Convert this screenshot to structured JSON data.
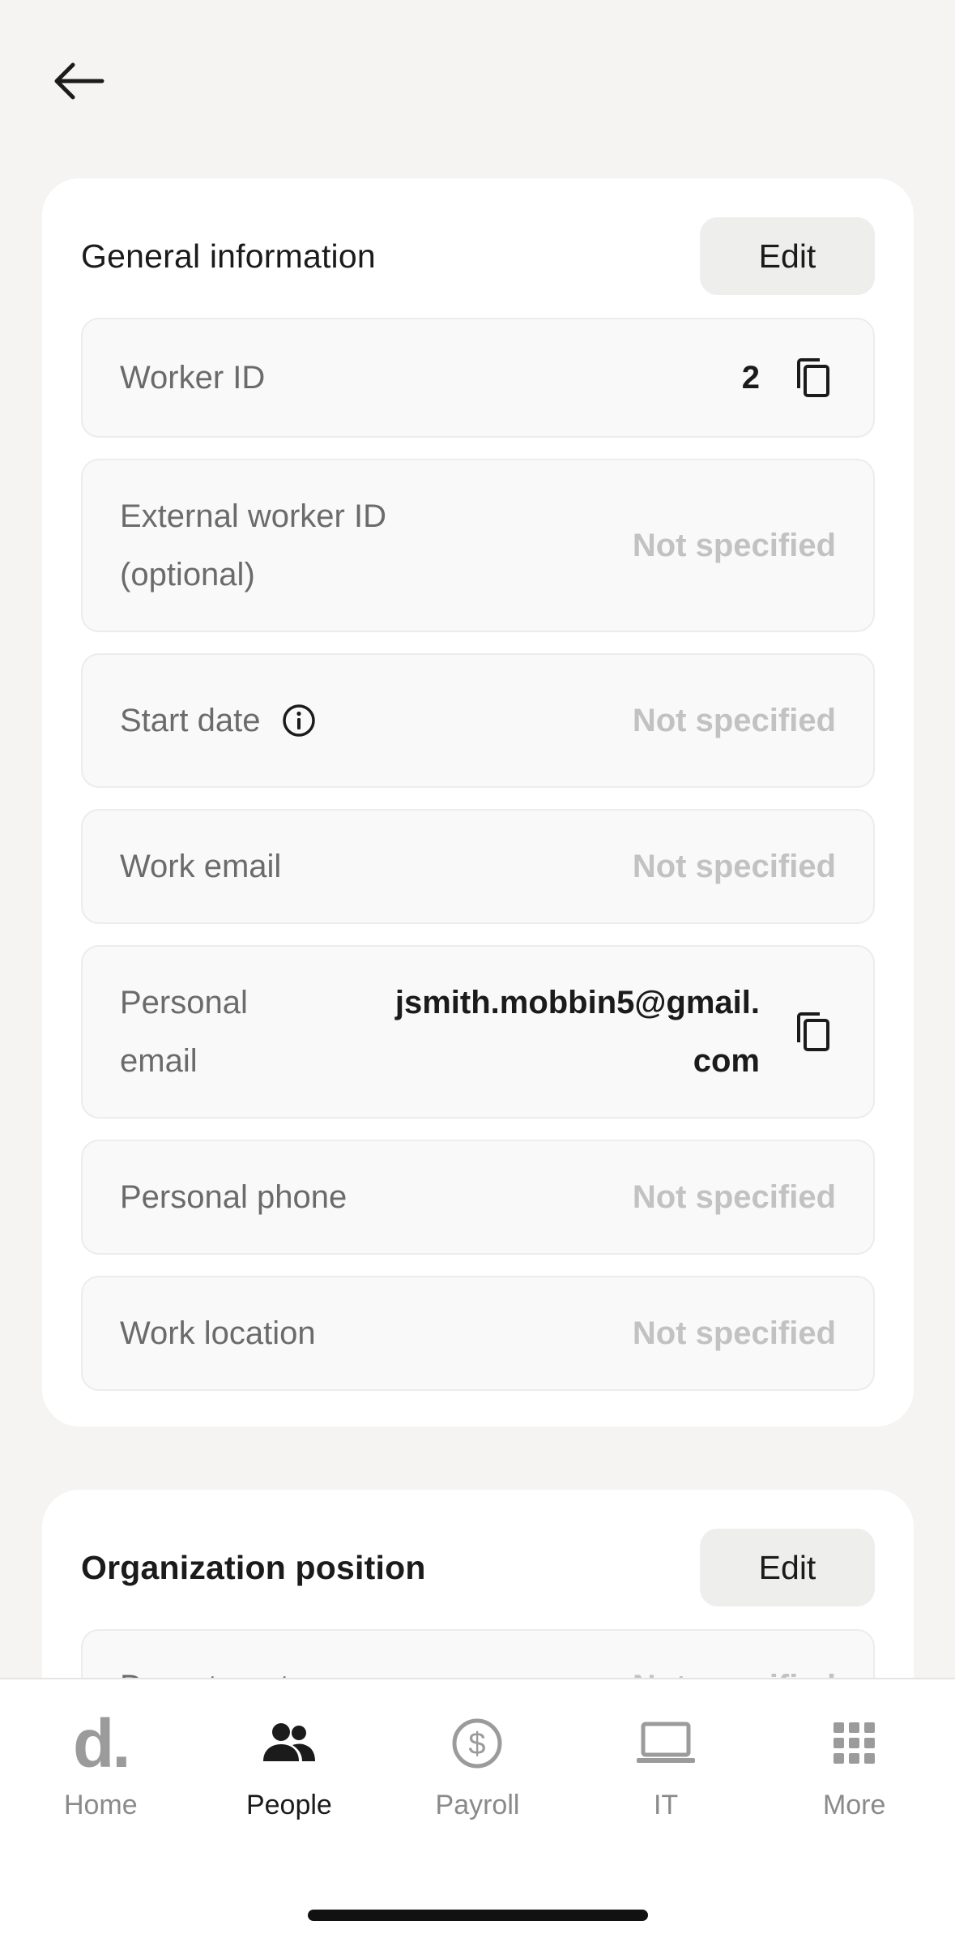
{
  "nav": {
    "back_icon": "arrow-left-icon"
  },
  "general": {
    "title": "General information",
    "edit_label": "Edit",
    "fields": {
      "worker_id": {
        "label": "Worker ID",
        "value": "2"
      },
      "external_worker_id": {
        "label": "External worker ID (optional)",
        "value": "Not specified"
      },
      "start_date": {
        "label": "Start date",
        "value": "Not specified"
      },
      "work_email": {
        "label": "Work email",
        "value": "Not specified"
      },
      "personal_email": {
        "label": "Personal email",
        "value": "jsmith.mobbin5@gmail.com"
      },
      "personal_phone": {
        "label": "Personal phone",
        "value": "Not specified"
      },
      "work_location": {
        "label": "Work location",
        "value": "Not specified"
      }
    }
  },
  "organization": {
    "title": "Organization position",
    "edit_label": "Edit",
    "department": {
      "label": "Department",
      "value": "Not specified"
    }
  },
  "tabbar": {
    "items": [
      {
        "label": "Home",
        "icon": "logo-d-icon"
      },
      {
        "label": "People",
        "icon": "people-icon"
      },
      {
        "label": "Payroll",
        "icon": "dollar-circle-icon"
      },
      {
        "label": "IT",
        "icon": "laptop-icon"
      },
      {
        "label": "More",
        "icon": "grid-icon"
      }
    ],
    "active": "People"
  },
  "colors": {
    "background": "#f5f4f2",
    "muted": "#c2c2c2",
    "text": "#1b1b1b"
  }
}
